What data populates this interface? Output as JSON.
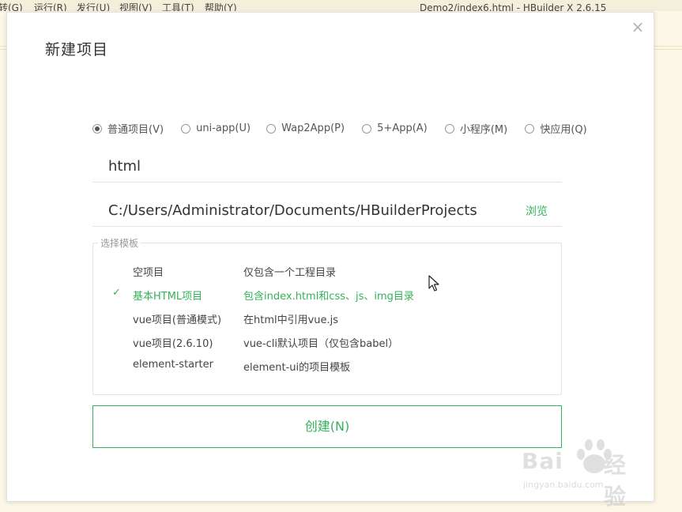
{
  "background": {
    "menu": [
      "转(G)",
      "运行(R)",
      "发行(U)",
      "视图(V)",
      "工具(T)",
      "帮助(Y)"
    ],
    "window_title": "Demo2/index6.html - HBuilder X 2.6.15"
  },
  "dialog": {
    "title": "新建项目",
    "project_types": [
      {
        "label": "普通项目(V)",
        "checked": true
      },
      {
        "label": "uni-app(U)",
        "checked": false
      },
      {
        "label": "Wap2App(P)",
        "checked": false
      },
      {
        "label": "5+App(A)",
        "checked": false
      },
      {
        "label": "小程序(M)",
        "checked": false
      },
      {
        "label": "快应用(Q)",
        "checked": false
      }
    ],
    "project_name": "html",
    "project_path": "C:/Users/Administrator/Documents/HBuilderProjects",
    "browse_label": "浏览",
    "template_legend": "选择模板",
    "templates": [
      {
        "name": "空项目",
        "desc": "仅包含一个工程目录",
        "selected": false
      },
      {
        "name": "基本HTML项目",
        "desc": "包含index.html和css、js、img目录",
        "selected": true
      },
      {
        "name": "vue项目(普通模式)",
        "desc": "在html中引用vue.js",
        "selected": false
      },
      {
        "name": "vue项目(2.6.10)",
        "desc": "vue-cli默认项目（仅包含babel）",
        "selected": false
      },
      {
        "name": "element-starter",
        "desc": "element-ui的项目模板",
        "selected": false
      }
    ],
    "create_label": "创建(N)",
    "check_mark": "✓",
    "close_glyph": "×"
  },
  "watermark": {
    "text": "Bai",
    "text2": "经验",
    "sub": "jingyan.baidu.com"
  },
  "colors": {
    "accent": "#36b15a",
    "background": "#fcf7e6"
  }
}
